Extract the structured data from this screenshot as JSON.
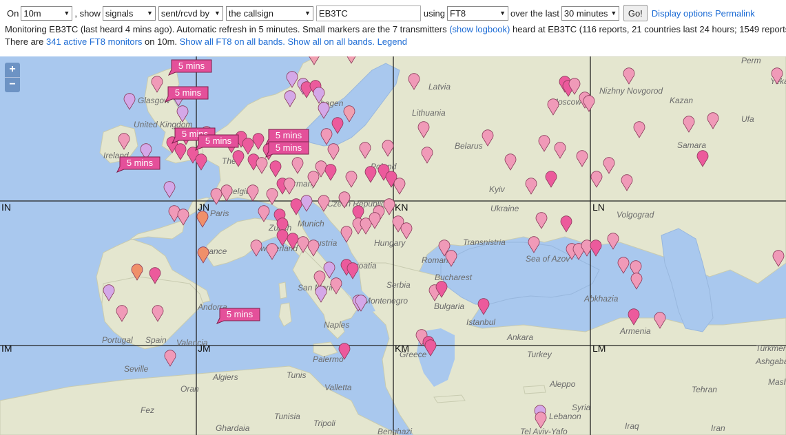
{
  "controls": {
    "on_label": "On",
    "band": "10m",
    "show_label": ", show",
    "show_what": "signals",
    "direction": "sent/rcvd by",
    "subject": "the callsign",
    "callsign": "EB3TC",
    "using_label": "using",
    "mode": "FT8",
    "over_label": "over the last",
    "period": "30 minutes",
    "go_label": "Go!",
    "display_options": "Display options",
    "permalink": "Permalink"
  },
  "status": {
    "line1_a": "Monitoring EB3TC (last heard 4 mins ago). Automatic refresh in 5 minutes. Small markers are the 7 transmitters ",
    "show_logbook": "(show logbook)",
    "line1_b": " heard at EB3TC (116 reports, 21 countries last 24 hours; 1549 reports, 3",
    "line2_a": "There are ",
    "active_monitors": "341 active FT8 monitors",
    "line2_b": " on 10m. ",
    "show_all_band": "Show all FT8 on all bands.",
    "show_all": "Show all on all bands.",
    "legend": "Legend"
  },
  "map": {
    "zoom_in": "+",
    "zoom_out": "−",
    "grid_labels": [
      "IN",
      "JN",
      "KN",
      "LN",
      "IM",
      "JM",
      "KM",
      "LM"
    ],
    "callouts": [
      "5 mins",
      "5 mins",
      "5 mins",
      "5 mins",
      "5 mins",
      "5 mins",
      "5 mins",
      "5 mins"
    ],
    "place_labels": [
      "Perm",
      "Yeka",
      "Latvia",
      "Nizhny Novgorod",
      "Kazan",
      "Lithuania",
      "Moscow",
      "Glasgow",
      "hagen",
      "United Kingdom",
      "Ufa",
      "Belarus",
      "Samara",
      "Ireland",
      "Poland",
      "The",
      "Germany",
      "Kyiv",
      "Belgium",
      "Czech Republic",
      "Ukraine",
      "Paris",
      "Munich",
      "Volgograd",
      "Zurich",
      "Transnistria",
      "France",
      "Switzerland",
      "Austria",
      "Hungary",
      "Sea of Azov",
      "Romania",
      "Croatia",
      "Bucharest",
      "Serbia",
      "San Marino",
      "Abkhazia",
      "Montenegro",
      "Bulgaria",
      "Portugal",
      "Spain",
      "Andorra",
      "Naples",
      "Istanbul",
      "Armenia",
      "Valencia",
      "Ankara",
      "Turkmen",
      "Ashgaba",
      "Greece",
      "Turkey",
      "Seville",
      "Palermo",
      "Mash",
      "Algiers",
      "Tunis",
      "Aleppo",
      "Tehran",
      "Oran",
      "Valletta",
      "Syria",
      "Fez",
      "Tunisia",
      "Tripoli",
      "Lebanon",
      "Iraq",
      "Iran",
      "Ghardaia",
      "Benghazi",
      "Tel Aviv-Yafo"
    ]
  }
}
